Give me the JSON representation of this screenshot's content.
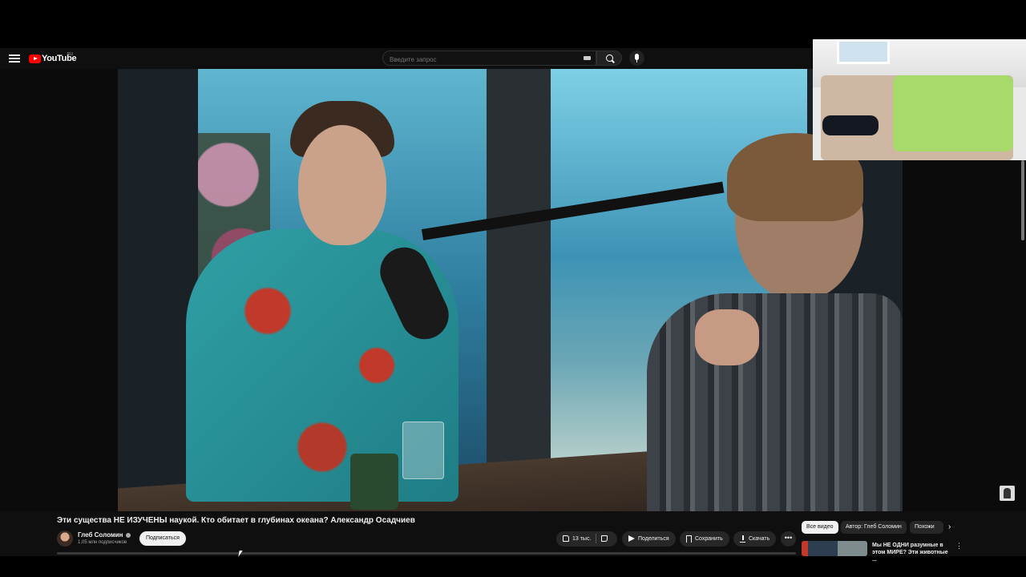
{
  "header": {
    "logo_text": "YouTube",
    "region": "RU",
    "search_placeholder": "Введите запрос"
  },
  "video": {
    "title": "Эти существа НЕ ИЗУЧЕНЫ наукой. Кто обитает в глубинах океана? Александр Осадчиев",
    "channel_name": "Глеб Соломин",
    "subscribers": "1,05 млн подписчиков",
    "subscribe_label": "Подписаться",
    "likes": "13 тыс.",
    "share_label": "Поделиться",
    "save_label": "Сохранить",
    "download_label": "Скачать",
    "more_label": "•••"
  },
  "sidebar": {
    "chips": [
      "Все видео",
      "Автор: Глеб Соломин",
      "Похожи"
    ],
    "next_label": "›",
    "recommendation": {
      "title": "Мы НЕ ОДНИ разумные в этом МИРЕ? Эти животные ...",
      "more_label": "⋮"
    }
  },
  "icons": {
    "menu": "hamburger-menu-icon",
    "search": "search-icon",
    "mic": "microphone-icon",
    "keyboard": "keyboard-icon",
    "like": "thumbs-up-icon",
    "dislike": "thumbs-down-icon",
    "share": "share-icon",
    "save": "save-playlist-icon",
    "download": "download-icon",
    "verified": "verified-badge-icon"
  },
  "colors": {
    "brand_red": "#ff0000",
    "background": "#0f0f0f",
    "chip_active": "#f1f1f1",
    "chip_inactive": "#272727"
  }
}
